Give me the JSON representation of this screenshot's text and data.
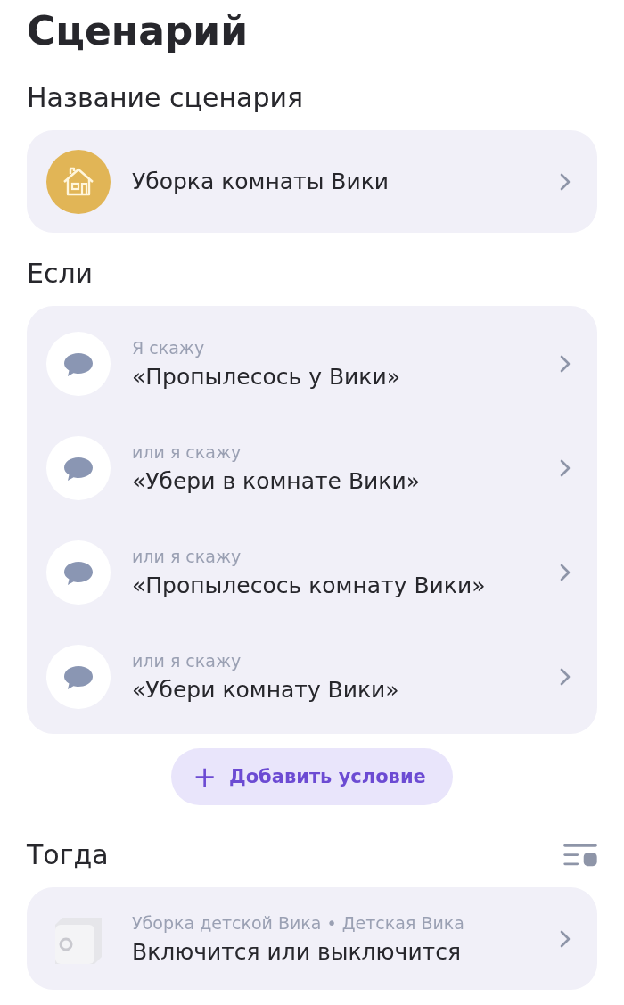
{
  "title": "Сценарий",
  "name_section": {
    "heading": "Название сценария",
    "name": "Уборка комнаты Вики"
  },
  "if_section": {
    "heading": "Если",
    "conditions": [
      {
        "kind": "phrase",
        "caption": "Я скажу",
        "phrase": "«Пропылесось у Вики»"
      },
      {
        "kind": "phrase",
        "caption": "или я скажу",
        "phrase": "«Убери в комнате Вики»"
      },
      {
        "kind": "phrase",
        "caption": "или я скажу",
        "phrase": "«Пропылесось комнату Вики»"
      },
      {
        "kind": "phrase",
        "caption": "или я скажу",
        "phrase": "«Убери комнату Вики»"
      }
    ],
    "add_button": {
      "icon": "+",
      "label": "Добавить условие"
    }
  },
  "then_section": {
    "heading": "Тогда",
    "actions": [
      {
        "kind": "device",
        "caption": "Уборка детской Вика • Детская Вика",
        "action": "Включится или выключится"
      }
    ]
  }
}
